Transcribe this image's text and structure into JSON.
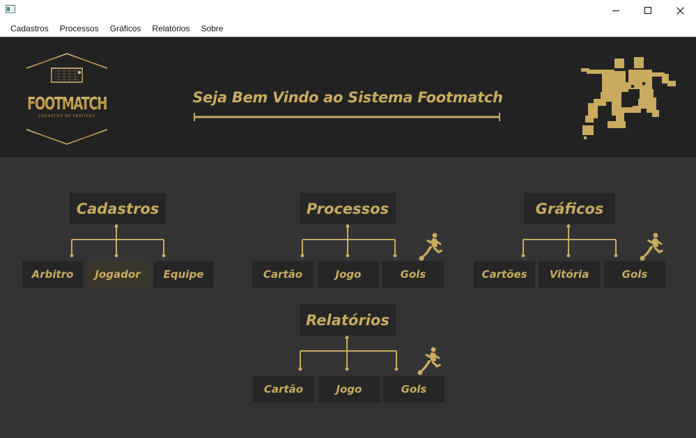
{
  "window": {
    "title": ""
  },
  "menu": [
    "Cadastros",
    "Processos",
    "Gráficos",
    "Relatórios",
    "Sobre"
  ],
  "header": {
    "logo_text": "FOOTMATCH",
    "logo_subtitle": "CADASTRO DE PARTIDAS",
    "welcome": "Seja Bem Vindo ao Sistema Footmatch"
  },
  "groups": {
    "cadastros": {
      "title": "Cadastros",
      "buttons": [
        "Arbitro",
        "Jogador",
        "Equipe"
      ]
    },
    "processos": {
      "title": "Processos",
      "buttons": [
        "Cartão",
        "Jogo",
        "Gols"
      ]
    },
    "graficos": {
      "title": "Gráficos",
      "buttons": [
        "Cartões",
        "Vitória",
        "Gols"
      ]
    },
    "relatorios": {
      "title": "Relatórios",
      "buttons": [
        "Cartão",
        "Jogo",
        "Gols"
      ]
    }
  },
  "colors": {
    "gold": "#c9ab5f",
    "header_bg": "#222222",
    "body_bg": "#333333",
    "button_bg": "#262626"
  },
  "icons": [
    "minimize-icon",
    "maximize-icon",
    "close-icon",
    "soccer-player-icon"
  ]
}
